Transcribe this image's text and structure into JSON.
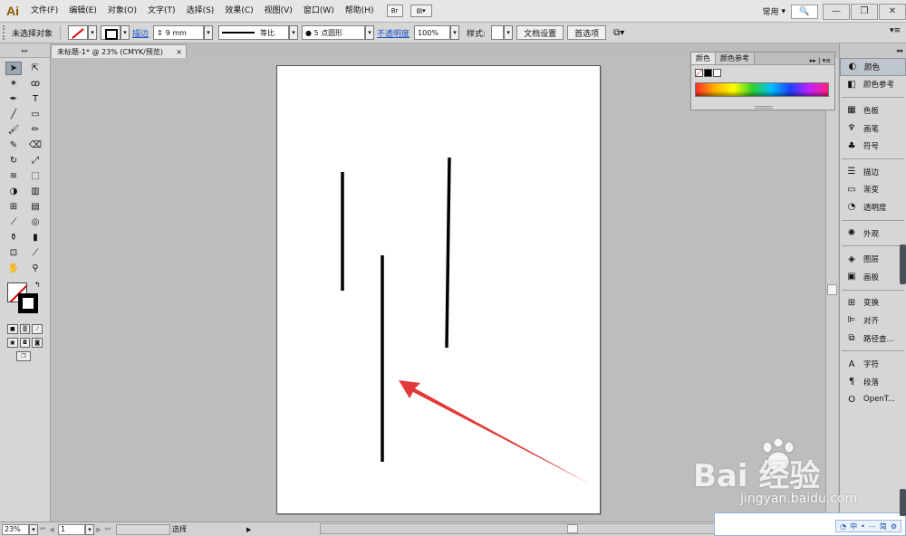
{
  "app": {
    "logo": "Ai",
    "workspace": "常用",
    "search_placeholder": "🔍"
  },
  "menu": [
    "文件(F)",
    "编辑(E)",
    "对象(O)",
    "文字(T)",
    "选择(S)",
    "效果(C)",
    "视图(V)",
    "窗口(W)",
    "帮助(H)"
  ],
  "menubar_icons": {
    "bridge": "Br",
    "arrange": "▤▾"
  },
  "window_buttons": {
    "minimize": "—",
    "restore": "❐",
    "close": "✕"
  },
  "control": {
    "selection_label": "未选择对象",
    "stroke_link": "描边",
    "stroke_weight": "9 mm",
    "stroke_profile": "等比",
    "brush": "● 5 点圆形",
    "opacity_link": "不透明度",
    "opacity_value": "100%",
    "style_label": "样式:",
    "doc_setup_button": "文档设置",
    "preferences_button": "首选项"
  },
  "document_tab": {
    "title": "未标题-1* @ 23% (CMYK/预览)",
    "close": "×"
  },
  "color_panel": {
    "tabs": [
      "颜色",
      "颜色参考"
    ],
    "controls": "▸▸ | ▾≡"
  },
  "dock": {
    "groups": [
      [
        {
          "icon": "palette-icon",
          "glyph": "◐",
          "label": "颜色",
          "active": true
        },
        {
          "icon": "color-guide-icon",
          "glyph": "◧",
          "label": "颜色参考",
          "active": false
        }
      ],
      [
        {
          "icon": "swatches-icon",
          "glyph": "▦",
          "label": "色板"
        },
        {
          "icon": "brushes-icon",
          "glyph": "♆",
          "label": "画笔"
        },
        {
          "icon": "symbols-icon",
          "glyph": "♣",
          "label": "符号"
        }
      ],
      [
        {
          "icon": "stroke-icon",
          "glyph": "☰",
          "label": "描边"
        },
        {
          "icon": "gradient-icon",
          "glyph": "▭",
          "label": "渐变"
        },
        {
          "icon": "transparency-icon",
          "glyph": "◔",
          "label": "透明度"
        }
      ],
      [
        {
          "icon": "appearance-icon",
          "glyph": "✺",
          "label": "外观"
        }
      ],
      [
        {
          "icon": "layers-icon",
          "glyph": "◈",
          "label": "图层"
        },
        {
          "icon": "artboards-icon",
          "glyph": "▣",
          "label": "画板"
        }
      ],
      [
        {
          "icon": "transform-icon",
          "glyph": "⊞",
          "label": "变换"
        },
        {
          "icon": "align-icon",
          "glyph": "⊫",
          "label": "对齐"
        },
        {
          "icon": "pathfinder-icon",
          "glyph": "⧉",
          "label": "路径查..."
        }
      ],
      [
        {
          "icon": "character-icon",
          "glyph": "A",
          "label": "字符"
        },
        {
          "icon": "paragraph-icon",
          "glyph": "¶",
          "label": "段落"
        },
        {
          "icon": "opentype-icon",
          "glyph": "O",
          "label": "OpenT..."
        }
      ]
    ]
  },
  "status": {
    "zoom": "23%",
    "page": "1",
    "tool": "选择"
  },
  "ime": {
    "items": [
      "中",
      "•",
      "⋯",
      "简",
      "⚙"
    ]
  },
  "watermark": {
    "brand": "Bai  经验",
    "url": "jingyan.baidu.com"
  },
  "colors": {
    "arrow": "#e23a3a",
    "line": "#000000"
  }
}
